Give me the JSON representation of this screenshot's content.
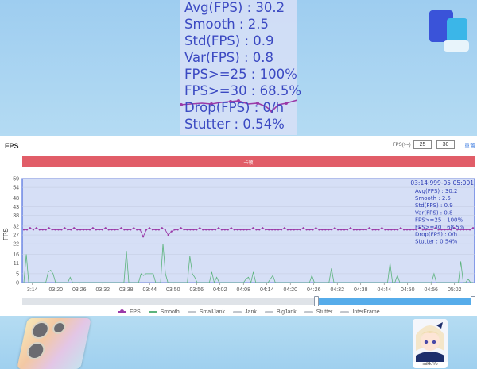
{
  "overlay": {
    "stats": [
      {
        "label": "Avg(FPS)",
        "value": "30.2"
      },
      {
        "label": "Smooth",
        "value": "2.5"
      },
      {
        "label": "Std(FPS)",
        "value": "0.9"
      },
      {
        "label": "Var(FPS)",
        "value": "0.8"
      },
      {
        "label": "FPS>=25",
        "value": "100%"
      },
      {
        "label": "FPS>=30",
        "value": "68.5%"
      },
      {
        "label": "Drop(FPS)",
        "value": "0/h"
      },
      {
        "label": "Stutter",
        "value": "0.54%"
      }
    ]
  },
  "panel": {
    "title": "FPS",
    "fps_ge_label": "FPS(>=)",
    "threshold_1": "25",
    "threshold_2": "30",
    "reset_label": "重置",
    "stutter_label": "卡顿"
  },
  "chart_data": {
    "type": "line",
    "ylabel": "FPS",
    "ylim": [
      0,
      59
    ],
    "y_ticks": [
      "0",
      "5",
      "11",
      "16",
      "22",
      "27",
      "32",
      "38",
      "43",
      "48",
      "54",
      "59"
    ],
    "x_ticks": [
      "3:14",
      "03:20",
      "03:26",
      "03:32",
      "03:38",
      "03:44",
      "03:50",
      "03:56",
      "04:02",
      "04:08",
      "04:14",
      "04:20",
      "04:26",
      "04:32",
      "04:38",
      "04:44",
      "04:50",
      "04:56",
      "05:02"
    ],
    "tooltip": {
      "time": "03:14:999-05:05:001",
      "rows": [
        "Avg(FPS)   : 30.2",
        "Smooth     : 2.5",
        "Std(FPS)   : 0.9",
        "Var(FPS)   : 0.8",
        "FPS>=25  : 100%",
        "FPS>=30  : 68.5%",
        "Drop(FPS) : 0/h",
        "Stutter    : 0.54%"
      ]
    },
    "series": [
      {
        "name": "FPS",
        "color": "#9b3aa8",
        "values": [
          30,
          30,
          31,
          30,
          31,
          30,
          30,
          30,
          31,
          30,
          30,
          30,
          30,
          31,
          30,
          30,
          31,
          30,
          30,
          30,
          30,
          30,
          31,
          30,
          30,
          30,
          31,
          30,
          30,
          30,
          30,
          31,
          30,
          30,
          30,
          31,
          30,
          30,
          26,
          30,
          31,
          30,
          30,
          30,
          31,
          30,
          27,
          29,
          30,
          30,
          31,
          30,
          30,
          30,
          30,
          30,
          31,
          30,
          30,
          30,
          30,
          30,
          31,
          30,
          30,
          30,
          31,
          30,
          30,
          30,
          30,
          30,
          30,
          31,
          30,
          30,
          31,
          30,
          30,
          30,
          30,
          30,
          30,
          31,
          30,
          30,
          30,
          30,
          30,
          31,
          30,
          30,
          30,
          31,
          30,
          30,
          30,
          30,
          30,
          31,
          30,
          30,
          30,
          30,
          31,
          30,
          30,
          30,
          30,
          30,
          31,
          30,
          30,
          30,
          31,
          30,
          30,
          30,
          30,
          30,
          31,
          30,
          30,
          30,
          30,
          30,
          31,
          30,
          30,
          30,
          30,
          31,
          30,
          30,
          30,
          30,
          30,
          31,
          30,
          30,
          30,
          30,
          30,
          31
        ]
      },
      {
        "name": "Smooth",
        "color": "#5bb37c",
        "values": [
          0,
          16,
          0,
          0,
          0,
          0,
          0,
          0,
          0,
          0,
          6,
          7,
          5,
          0,
          0,
          0,
          0,
          0,
          0,
          3,
          0,
          0,
          0,
          0,
          0,
          0,
          0,
          0,
          0,
          0,
          0,
          0,
          0,
          0,
          0,
          0,
          0,
          0,
          0,
          0,
          0,
          0,
          18,
          0,
          0,
          0,
          0,
          0,
          5,
          4,
          5,
          5,
          5,
          5,
          0,
          0,
          0,
          22,
          5,
          0,
          0,
          0,
          0,
          0,
          0,
          0,
          0,
          0,
          15,
          5,
          3,
          0,
          0,
          0,
          0,
          0,
          0,
          6,
          0,
          3,
          0,
          0,
          0,
          0,
          0,
          0,
          0,
          0,
          0,
          0,
          0,
          2,
          3,
          0,
          6,
          0,
          0,
          0,
          0,
          0,
          0,
          2,
          4,
          0,
          0,
          0,
          0,
          0,
          0,
          0,
          0,
          0,
          0,
          0,
          0,
          0,
          0,
          0,
          4,
          0,
          0,
          0,
          0,
          0,
          0,
          0,
          8,
          0,
          0,
          0,
          0,
          0,
          0,
          0,
          0,
          0,
          0,
          0,
          0,
          0,
          0,
          0,
          0,
          0,
          0,
          0,
          0,
          0,
          0,
          0,
          11,
          0,
          0,
          4,
          0,
          0,
          0,
          0,
          0,
          0,
          0,
          0,
          0,
          0,
          0,
          0,
          0,
          0,
          5,
          0,
          0,
          0,
          0,
          0,
          0,
          0,
          0,
          0,
          0,
          12,
          0,
          0,
          2,
          0,
          0
        ]
      }
    ],
    "legend": [
      {
        "name": "FPS",
        "color": "#9b3aa8",
        "dot": true
      },
      {
        "name": "Smooth",
        "color": "#5bb37c",
        "dot": false
      },
      {
        "name": "SmallJank",
        "color": "#c2c6cc",
        "dot": false
      },
      {
        "name": "Jank",
        "color": "#c2c6cc",
        "dot": false
      },
      {
        "name": "BigJank",
        "color": "#c2c6cc",
        "dot": false
      },
      {
        "name": "Stutter",
        "color": "#c2c6cc",
        "dot": false
      },
      {
        "name": "InterFrame",
        "color": "#c2c6cc",
        "dot": false
      }
    ],
    "legend_position": "bottom",
    "grid": true,
    "selected_range": [
      0.65,
      1.0
    ]
  },
  "avatar_label": "miHoYo"
}
